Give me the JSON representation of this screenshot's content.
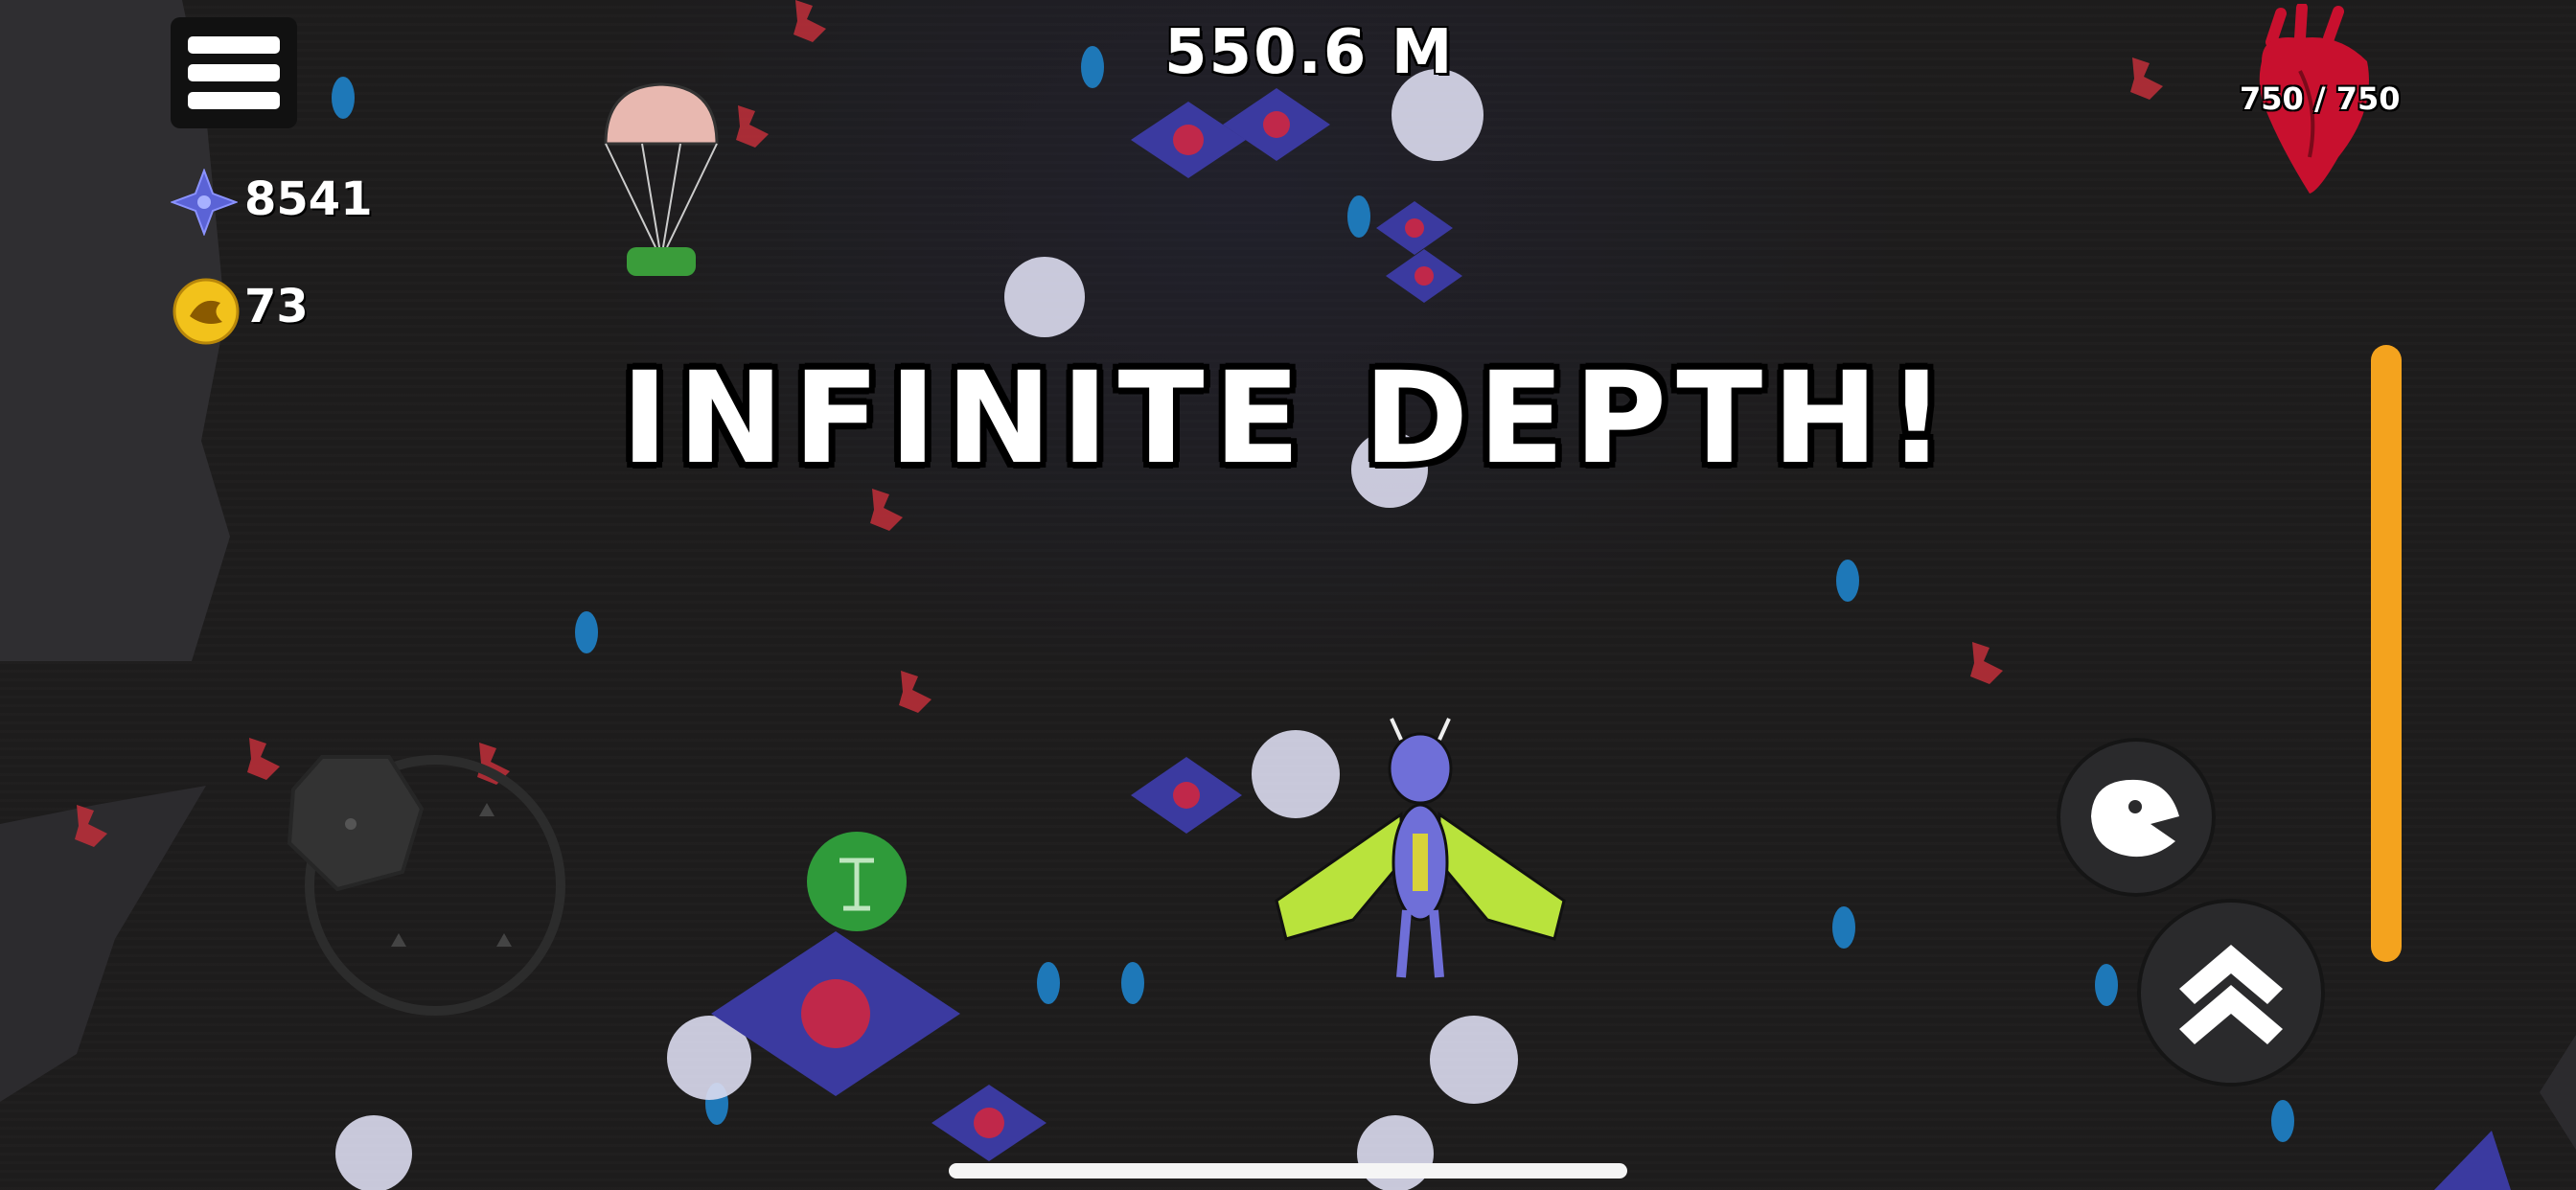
{
  "hud": {
    "depth": "550.6 M",
    "gems": "8541",
    "coins": "73",
    "health": "750 / 750"
  },
  "banner": "INFINITE DEPTH!",
  "icons": {
    "menu": "hamburger-menu-icon",
    "gem": "star-gem-icon",
    "coin": "dragon-coin-icon",
    "health": "anatomical-heart-icon",
    "dash": "dash-claw-icon",
    "jump": "double-chevron-up-icon"
  },
  "colors": {
    "fuel_bar": "#f4a31e",
    "heart": "#c8102e",
    "gem": "#5b63d6",
    "coin": "#f2c21b",
    "dragon_body": "#6f6fd8",
    "dragon_wings": "#b9e33c"
  },
  "fuel_level": 1.0
}
